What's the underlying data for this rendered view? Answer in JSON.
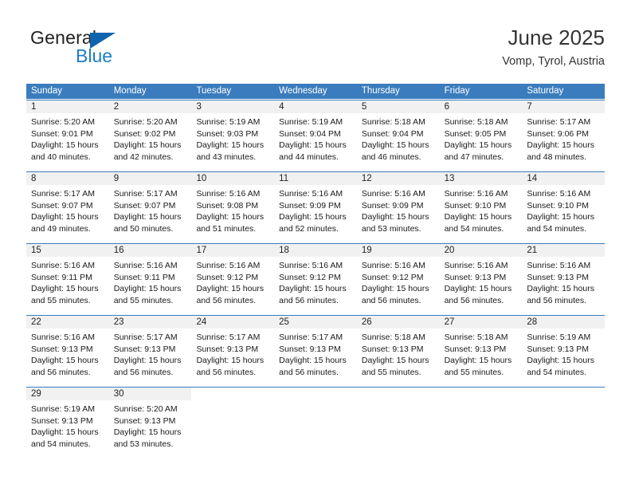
{
  "brand": {
    "word1": "General",
    "word2": "Blue",
    "accent_color": "#1064ad",
    "text_color": "#1a7ec8"
  },
  "header": {
    "title": "June 2025",
    "location": "Vomp, Tyrol, Austria"
  },
  "theme": {
    "header_bar": "#3a7cbe",
    "daynum_bg": "#f1f1f1",
    "text": "#1a1a1a"
  },
  "calendar": {
    "weekday_headers": [
      "Sunday",
      "Monday",
      "Tuesday",
      "Wednesday",
      "Thursday",
      "Friday",
      "Saturday"
    ],
    "weeks": [
      [
        {
          "day": "1",
          "sunrise": "Sunrise: 5:20 AM",
          "sunset": "Sunset: 9:01 PM",
          "daylight_1": "Daylight: 15 hours",
          "daylight_2": "and 40 minutes."
        },
        {
          "day": "2",
          "sunrise": "Sunrise: 5:20 AM",
          "sunset": "Sunset: 9:02 PM",
          "daylight_1": "Daylight: 15 hours",
          "daylight_2": "and 42 minutes."
        },
        {
          "day": "3",
          "sunrise": "Sunrise: 5:19 AM",
          "sunset": "Sunset: 9:03 PM",
          "daylight_1": "Daylight: 15 hours",
          "daylight_2": "and 43 minutes."
        },
        {
          "day": "4",
          "sunrise": "Sunrise: 5:19 AM",
          "sunset": "Sunset: 9:04 PM",
          "daylight_1": "Daylight: 15 hours",
          "daylight_2": "and 44 minutes."
        },
        {
          "day": "5",
          "sunrise": "Sunrise: 5:18 AM",
          "sunset": "Sunset: 9:04 PM",
          "daylight_1": "Daylight: 15 hours",
          "daylight_2": "and 46 minutes."
        },
        {
          "day": "6",
          "sunrise": "Sunrise: 5:18 AM",
          "sunset": "Sunset: 9:05 PM",
          "daylight_1": "Daylight: 15 hours",
          "daylight_2": "and 47 minutes."
        },
        {
          "day": "7",
          "sunrise": "Sunrise: 5:17 AM",
          "sunset": "Sunset: 9:06 PM",
          "daylight_1": "Daylight: 15 hours",
          "daylight_2": "and 48 minutes."
        }
      ],
      [
        {
          "day": "8",
          "sunrise": "Sunrise: 5:17 AM",
          "sunset": "Sunset: 9:07 PM",
          "daylight_1": "Daylight: 15 hours",
          "daylight_2": "and 49 minutes."
        },
        {
          "day": "9",
          "sunrise": "Sunrise: 5:17 AM",
          "sunset": "Sunset: 9:07 PM",
          "daylight_1": "Daylight: 15 hours",
          "daylight_2": "and 50 minutes."
        },
        {
          "day": "10",
          "sunrise": "Sunrise: 5:16 AM",
          "sunset": "Sunset: 9:08 PM",
          "daylight_1": "Daylight: 15 hours",
          "daylight_2": "and 51 minutes."
        },
        {
          "day": "11",
          "sunrise": "Sunrise: 5:16 AM",
          "sunset": "Sunset: 9:09 PM",
          "daylight_1": "Daylight: 15 hours",
          "daylight_2": "and 52 minutes."
        },
        {
          "day": "12",
          "sunrise": "Sunrise: 5:16 AM",
          "sunset": "Sunset: 9:09 PM",
          "daylight_1": "Daylight: 15 hours",
          "daylight_2": "and 53 minutes."
        },
        {
          "day": "13",
          "sunrise": "Sunrise: 5:16 AM",
          "sunset": "Sunset: 9:10 PM",
          "daylight_1": "Daylight: 15 hours",
          "daylight_2": "and 54 minutes."
        },
        {
          "day": "14",
          "sunrise": "Sunrise: 5:16 AM",
          "sunset": "Sunset: 9:10 PM",
          "daylight_1": "Daylight: 15 hours",
          "daylight_2": "and 54 minutes."
        }
      ],
      [
        {
          "day": "15",
          "sunrise": "Sunrise: 5:16 AM",
          "sunset": "Sunset: 9:11 PM",
          "daylight_1": "Daylight: 15 hours",
          "daylight_2": "and 55 minutes."
        },
        {
          "day": "16",
          "sunrise": "Sunrise: 5:16 AM",
          "sunset": "Sunset: 9:11 PM",
          "daylight_1": "Daylight: 15 hours",
          "daylight_2": "and 55 minutes."
        },
        {
          "day": "17",
          "sunrise": "Sunrise: 5:16 AM",
          "sunset": "Sunset: 9:12 PM",
          "daylight_1": "Daylight: 15 hours",
          "daylight_2": "and 56 minutes."
        },
        {
          "day": "18",
          "sunrise": "Sunrise: 5:16 AM",
          "sunset": "Sunset: 9:12 PM",
          "daylight_1": "Daylight: 15 hours",
          "daylight_2": "and 56 minutes."
        },
        {
          "day": "19",
          "sunrise": "Sunrise: 5:16 AM",
          "sunset": "Sunset: 9:12 PM",
          "daylight_1": "Daylight: 15 hours",
          "daylight_2": "and 56 minutes."
        },
        {
          "day": "20",
          "sunrise": "Sunrise: 5:16 AM",
          "sunset": "Sunset: 9:13 PM",
          "daylight_1": "Daylight: 15 hours",
          "daylight_2": "and 56 minutes."
        },
        {
          "day": "21",
          "sunrise": "Sunrise: 5:16 AM",
          "sunset": "Sunset: 9:13 PM",
          "daylight_1": "Daylight: 15 hours",
          "daylight_2": "and 56 minutes."
        }
      ],
      [
        {
          "day": "22",
          "sunrise": "Sunrise: 5:16 AM",
          "sunset": "Sunset: 9:13 PM",
          "daylight_1": "Daylight: 15 hours",
          "daylight_2": "and 56 minutes."
        },
        {
          "day": "23",
          "sunrise": "Sunrise: 5:17 AM",
          "sunset": "Sunset: 9:13 PM",
          "daylight_1": "Daylight: 15 hours",
          "daylight_2": "and 56 minutes."
        },
        {
          "day": "24",
          "sunrise": "Sunrise: 5:17 AM",
          "sunset": "Sunset: 9:13 PM",
          "daylight_1": "Daylight: 15 hours",
          "daylight_2": "and 56 minutes."
        },
        {
          "day": "25",
          "sunrise": "Sunrise: 5:17 AM",
          "sunset": "Sunset: 9:13 PM",
          "daylight_1": "Daylight: 15 hours",
          "daylight_2": "and 56 minutes."
        },
        {
          "day": "26",
          "sunrise": "Sunrise: 5:18 AM",
          "sunset": "Sunset: 9:13 PM",
          "daylight_1": "Daylight: 15 hours",
          "daylight_2": "and 55 minutes."
        },
        {
          "day": "27",
          "sunrise": "Sunrise: 5:18 AM",
          "sunset": "Sunset: 9:13 PM",
          "daylight_1": "Daylight: 15 hours",
          "daylight_2": "and 55 minutes."
        },
        {
          "day": "28",
          "sunrise": "Sunrise: 5:19 AM",
          "sunset": "Sunset: 9:13 PM",
          "daylight_1": "Daylight: 15 hours",
          "daylight_2": "and 54 minutes."
        }
      ],
      [
        {
          "day": "29",
          "sunrise": "Sunrise: 5:19 AM",
          "sunset": "Sunset: 9:13 PM",
          "daylight_1": "Daylight: 15 hours",
          "daylight_2": "and 54 minutes."
        },
        {
          "day": "30",
          "sunrise": "Sunrise: 5:20 AM",
          "sunset": "Sunset: 9:13 PM",
          "daylight_1": "Daylight: 15 hours",
          "daylight_2": "and 53 minutes."
        },
        {
          "day": "",
          "sunrise": "",
          "sunset": "",
          "daylight_1": "",
          "daylight_2": ""
        },
        {
          "day": "",
          "sunrise": "",
          "sunset": "",
          "daylight_1": "",
          "daylight_2": ""
        },
        {
          "day": "",
          "sunrise": "",
          "sunset": "",
          "daylight_1": "",
          "daylight_2": ""
        },
        {
          "day": "",
          "sunrise": "",
          "sunset": "",
          "daylight_1": "",
          "daylight_2": ""
        },
        {
          "day": "",
          "sunrise": "",
          "sunset": "",
          "daylight_1": "",
          "daylight_2": ""
        }
      ]
    ]
  }
}
